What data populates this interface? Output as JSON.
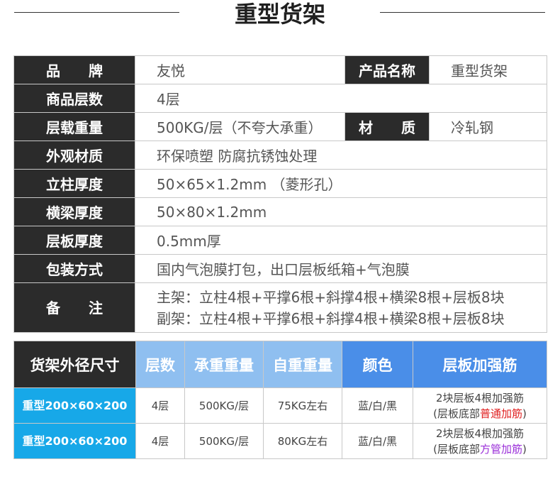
{
  "title": "重型货架",
  "spec": {
    "brand_label": "品　　牌",
    "brand_value": "友悦",
    "product_name_label": "产品名称",
    "product_name_value": "重型货架",
    "layers_label": "商品层数",
    "layers_value": "4层",
    "load_label": "层载重量",
    "load_value": "500KG/层（不夸大承重）",
    "material_label": "材　　质",
    "material_value": "冷轧钢",
    "finish_label": "外观材质",
    "finish_value": "环保喷塑 防腐抗锈蚀处理",
    "post_label": "立柱厚度",
    "post_value": "50×65×1.2mm （菱形孔）",
    "beam_label": "横梁厚度",
    "beam_value": "50×80×1.2mm",
    "shelf_label": "层板厚度",
    "shelf_value": "0.5mm厚",
    "packing_label": "包装方式",
    "packing_value": "国内气泡膜打包，出口层板纸箱+气泡膜",
    "remarks_label": "备　　注",
    "remarks_line1": "主架：立柱4根+平撑6根+斜撑4根+横梁8根+层板8块",
    "remarks_line2": "副架：立柱4根+平撑6根+斜撑4根+横梁8根+层板8块"
  },
  "sizes": {
    "headers": [
      "货架外径尺寸",
      "层数",
      "承重重量",
      "自重重量",
      "颜色",
      "层板加强筋"
    ],
    "rows": [
      {
        "model": "重型200×60×200",
        "layers": "4层",
        "load": "500KG/层",
        "weight": "75KG左右",
        "color": "蓝/白/黑",
        "rib_line1": "2块层板4根加强筋",
        "rib_line2_prefix": "(层板底部",
        "rib_line2_highlight": "普通加筋",
        "rib_line2_suffix": ")"
      },
      {
        "model": "重型200×60×200",
        "layers": "4层",
        "load": "500KG/层",
        "weight": "80KG左右",
        "color": "蓝/白/黑",
        "rib_line1": "2块层板4根加强筋",
        "rib_line2_prefix": "(层板底部",
        "rib_line2_highlight": "方管加筋",
        "rib_line2_suffix": ")"
      }
    ]
  },
  "colors": {
    "label_bg": "#2b2b2b",
    "header_black": "#2b2b2b",
    "header_light_blue": "#8fbff0",
    "header_blue": "#4a8ee8",
    "model_blue": "#17a8e8",
    "highlight_red": "#e02020",
    "highlight_purple": "#9b30d9"
  }
}
